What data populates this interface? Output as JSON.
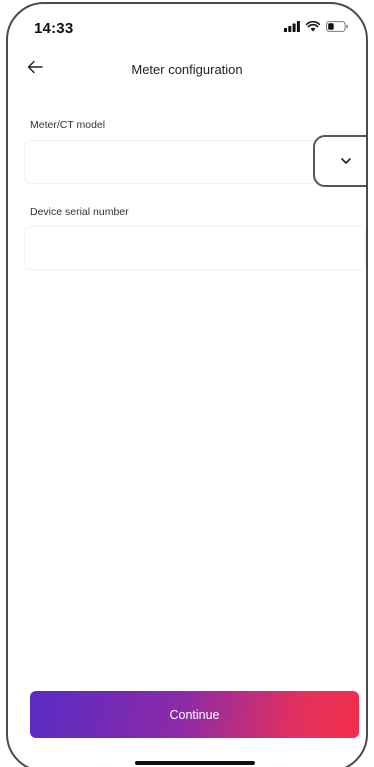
{
  "status_bar": {
    "time": "14:33",
    "icons": [
      "signal-icon",
      "wifi-icon",
      "battery-icon"
    ]
  },
  "nav": {
    "back_icon": "arrow-left-icon",
    "title": "Meter configuration"
  },
  "form": {
    "model": {
      "label": "Meter/CT model",
      "value": "",
      "dropdown_icon": "chevron-down-icon"
    },
    "serial": {
      "label": "Device serial number",
      "value": "",
      "placeholder": ""
    }
  },
  "actions": {
    "continue_label": "Continue"
  },
  "colors": {
    "gradient_start": "#5a2bc4",
    "gradient_end": "#f42e4a",
    "frame": "#4a4a4a"
  }
}
